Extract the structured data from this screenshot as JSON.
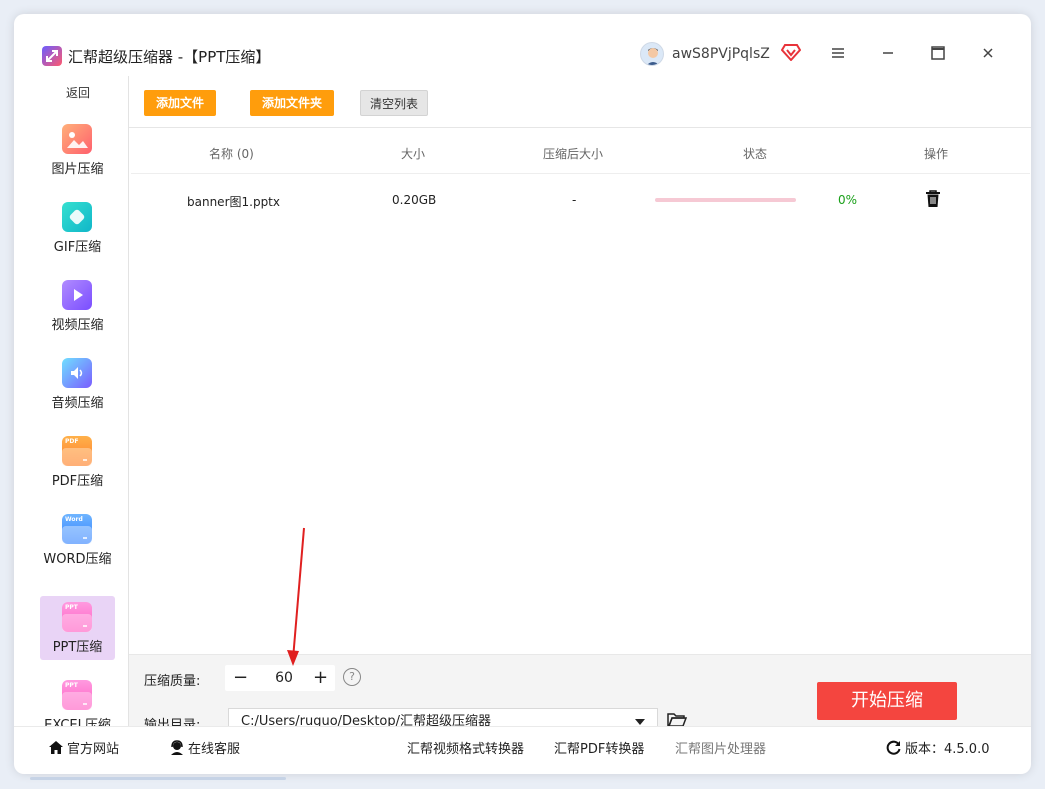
{
  "window": {
    "title": "汇帮超级压缩器  -【PPT压缩】",
    "user_name": "awS8PVjPqlsZ"
  },
  "sidebar": {
    "back_label": "返回",
    "items": [
      {
        "label": "图片压缩",
        "icon": "image-icon",
        "color": "#ff7a59"
      },
      {
        "label": "GIF压缩",
        "icon": "gif-icon",
        "color": "#1ec8c8"
      },
      {
        "label": "视频压缩",
        "icon": "video-play-icon",
        "color": "#8a5cf6"
      },
      {
        "label": "音频压缩",
        "icon": "audio-icon",
        "color": "#5aa2ff"
      },
      {
        "label": "PDF压缩",
        "icon": "pdf-file-icon",
        "color": "#ff8a3d",
        "tag": "PDF"
      },
      {
        "label": "WORD压缩",
        "icon": "word-file-icon",
        "color": "#3d8bff",
        "tag": "Word"
      },
      {
        "label": "PPT压缩",
        "icon": "ppt-file-icon",
        "color": "#ff6ec7",
        "tag": "PPT"
      },
      {
        "label": "EXCEL压缩",
        "icon": "excel-file-icon",
        "color": "#ff6ec7",
        "tag": "PPT"
      }
    ],
    "active_index": 6
  },
  "toolbar": {
    "add_file": "添加文件",
    "add_folder": "添加文件夹",
    "clear_list": "清空列表"
  },
  "table": {
    "headers": {
      "name": "名称 (0)",
      "size": "大小",
      "compressed_size": "压缩后大小",
      "status": "状态",
      "action": "操作"
    },
    "rows": [
      {
        "name": "banner图1.pptx",
        "size": "0.20GB",
        "compressed_size": "-",
        "progress": 0,
        "percent": "0%"
      }
    ]
  },
  "settings": {
    "quality_label": "压缩质量:",
    "quality_value": "60",
    "minus": "−",
    "plus": "+",
    "help": "?",
    "output_label": "输出目录:",
    "output_path": "C:/Users/ruguo/Desktop/汇帮超级压缩器",
    "start_button": "开始压缩"
  },
  "footer": {
    "website": "官方网站",
    "support": "在线客服",
    "video_converter": "汇帮视频格式转换器",
    "pdf_converter": "汇帮PDF转换器",
    "image_processor": "汇帮图片处理器",
    "version": "版本：4.5.0.0"
  },
  "colors": {
    "accent_orange": "#ff9d0c",
    "start_red": "#f4453f",
    "active_sidebar": "#e9d4f6",
    "progress_green": "#1aa01a"
  }
}
